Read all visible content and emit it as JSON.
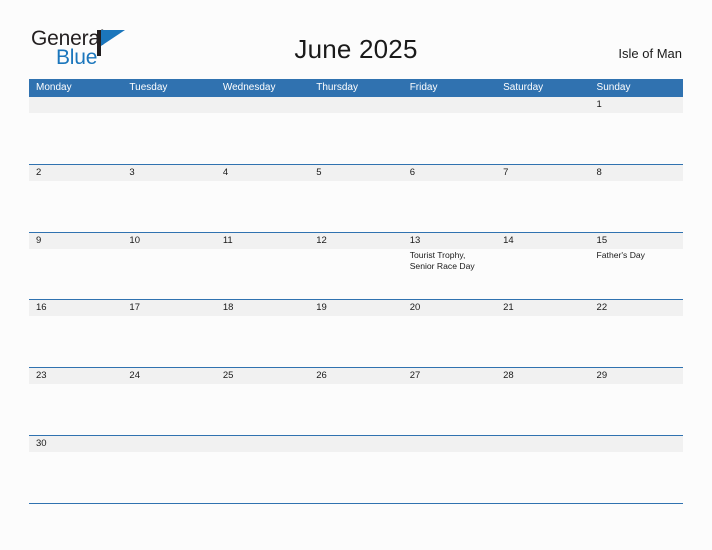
{
  "brand": {
    "word_one": "General",
    "word_two": "Blue",
    "flag_icon": "general-blue-flag-icon",
    "accent_color": "#1b76bc"
  },
  "header": {
    "title": "June 2025",
    "location": "Isle of Man"
  },
  "colors": {
    "header_blue": "#3072b0",
    "daynum_band_gray": "#f1f1f1",
    "page_background": "#fcfcfc",
    "text": "#1a1a1a",
    "weekday_text": "#ffffff"
  },
  "calendar": {
    "weekdays": [
      "Monday",
      "Tuesday",
      "Wednesday",
      "Thursday",
      "Friday",
      "Saturday",
      "Sunday"
    ],
    "weeks": [
      {
        "days": [
          {
            "num": "",
            "events": []
          },
          {
            "num": "",
            "events": []
          },
          {
            "num": "",
            "events": []
          },
          {
            "num": "",
            "events": []
          },
          {
            "num": "",
            "events": []
          },
          {
            "num": "",
            "events": []
          },
          {
            "num": "1",
            "events": []
          }
        ]
      },
      {
        "days": [
          {
            "num": "2",
            "events": []
          },
          {
            "num": "3",
            "events": []
          },
          {
            "num": "4",
            "events": []
          },
          {
            "num": "5",
            "events": []
          },
          {
            "num": "6",
            "events": []
          },
          {
            "num": "7",
            "events": []
          },
          {
            "num": "8",
            "events": []
          }
        ]
      },
      {
        "days": [
          {
            "num": "9",
            "events": []
          },
          {
            "num": "10",
            "events": []
          },
          {
            "num": "11",
            "events": []
          },
          {
            "num": "12",
            "events": []
          },
          {
            "num": "13",
            "events": [
              "Tourist Trophy,",
              "Senior Race Day"
            ]
          },
          {
            "num": "14",
            "events": []
          },
          {
            "num": "15",
            "events": [
              "Father's Day"
            ]
          }
        ]
      },
      {
        "days": [
          {
            "num": "16",
            "events": []
          },
          {
            "num": "17",
            "events": []
          },
          {
            "num": "18",
            "events": []
          },
          {
            "num": "19",
            "events": []
          },
          {
            "num": "20",
            "events": []
          },
          {
            "num": "21",
            "events": []
          },
          {
            "num": "22",
            "events": []
          }
        ]
      },
      {
        "days": [
          {
            "num": "23",
            "events": []
          },
          {
            "num": "24",
            "events": []
          },
          {
            "num": "25",
            "events": []
          },
          {
            "num": "26",
            "events": []
          },
          {
            "num": "27",
            "events": []
          },
          {
            "num": "28",
            "events": []
          },
          {
            "num": "29",
            "events": []
          }
        ]
      },
      {
        "days": [
          {
            "num": "30",
            "events": []
          },
          {
            "num": "",
            "events": []
          },
          {
            "num": "",
            "events": []
          },
          {
            "num": "",
            "events": []
          },
          {
            "num": "",
            "events": []
          },
          {
            "num": "",
            "events": []
          },
          {
            "num": "",
            "events": []
          }
        ]
      }
    ]
  }
}
